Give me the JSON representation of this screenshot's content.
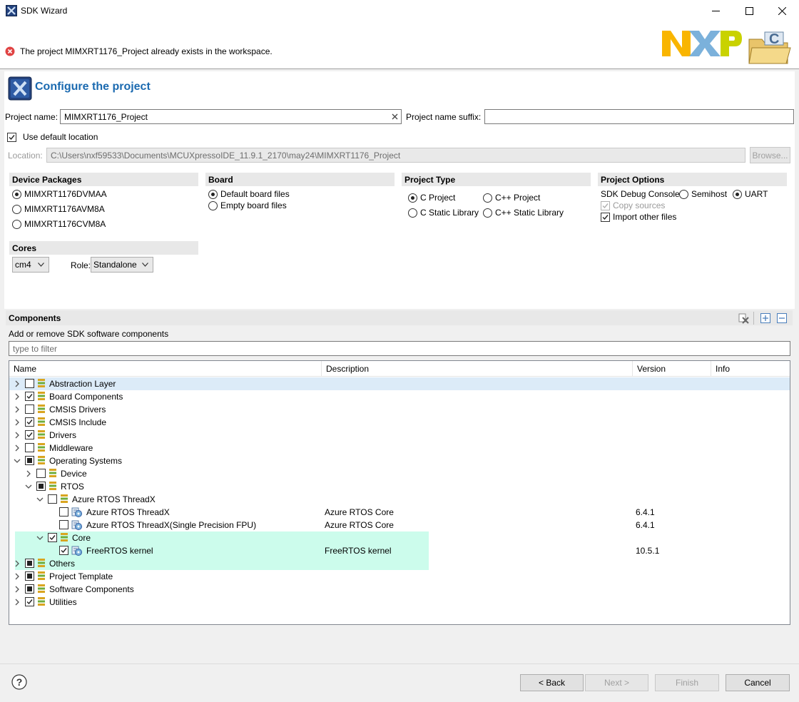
{
  "window": {
    "title": "SDK Wizard",
    "minimize_icon": "minimize-icon",
    "maximize_icon": "maximize-icon",
    "close_icon": "close-icon"
  },
  "banner": {
    "error_message": "The project MIMXRT1176_Project already exists in the workspace.",
    "logo_text": "NXP",
    "folder_letter": "C"
  },
  "page": {
    "title": "Configure the project"
  },
  "project": {
    "name_label": "Project name:",
    "name_value": "MIMXRT1176_Project",
    "suffix_label": "Project name suffix:",
    "suffix_value": "",
    "use_default_location_label": "Use default location",
    "use_default_location_checked": true,
    "location_label": "Location:",
    "location_value": "C:\\Users\\nxf59533\\Documents\\MCUXpressoIDE_11.9.1_2170\\may24\\MIMXRT1176_Project",
    "browse_label": "Browse..."
  },
  "device_packages": {
    "title": "Device Packages",
    "options": [
      "MIMXRT1176DVMAA",
      "MIMXRT1176AVM8A",
      "MIMXRT1176CVM8A"
    ],
    "selected": "MIMXRT1176DVMAA"
  },
  "board": {
    "title": "Board",
    "options": [
      "Default board files",
      "Empty board files"
    ],
    "selected": "Default board files"
  },
  "project_type": {
    "title": "Project Type",
    "options": [
      "C Project",
      "C++ Project",
      "C Static Library",
      "C++ Static Library"
    ],
    "selected": "C Project"
  },
  "project_options": {
    "title": "Project Options",
    "debug_console_label": "SDK Debug Console",
    "debug_console_options": [
      "Semihost",
      "UART"
    ],
    "debug_console_selected": "UART",
    "copy_sources_label": "Copy sources",
    "import_other_files_label": "Import other files"
  },
  "cores": {
    "title": "Cores",
    "core_value": "cm4",
    "role_label": "Role:",
    "role_value": "Standalone"
  },
  "components": {
    "title": "Components",
    "subtitle": "Add or remove SDK software components",
    "filter_placeholder": "type to filter",
    "columns": [
      "Name",
      "Description",
      "Version",
      "Info"
    ],
    "rows": [
      {
        "label": "Abstraction Layer",
        "desc": "",
        "ver": "",
        "level": 0,
        "exp": "closed",
        "check": "none",
        "icon": "package-icon",
        "bg": "#dcebf8"
      },
      {
        "label": "Board Components",
        "desc": "",
        "ver": "",
        "level": 0,
        "exp": "closed",
        "check": "checked",
        "icon": "package-icon",
        "bg": ""
      },
      {
        "label": "CMSIS Drivers",
        "desc": "",
        "ver": "",
        "level": 0,
        "exp": "closed",
        "check": "none",
        "icon": "package-icon",
        "bg": ""
      },
      {
        "label": "CMSIS Include",
        "desc": "",
        "ver": "",
        "level": 0,
        "exp": "closed",
        "check": "checked",
        "icon": "package-icon",
        "bg": ""
      },
      {
        "label": "Drivers",
        "desc": "",
        "ver": "",
        "level": 0,
        "exp": "closed",
        "check": "checked",
        "icon": "package-icon",
        "bg": ""
      },
      {
        "label": "Middleware",
        "desc": "",
        "ver": "",
        "level": 0,
        "exp": "closed",
        "check": "none",
        "icon": "package-icon",
        "bg": ""
      },
      {
        "label": "Operating Systems",
        "desc": "",
        "ver": "",
        "level": 0,
        "exp": "open",
        "check": "partial",
        "icon": "package-icon",
        "bg": ""
      },
      {
        "label": "Device",
        "desc": "",
        "ver": "",
        "level": 1,
        "exp": "closed",
        "check": "none",
        "icon": "package-icon",
        "bg": ""
      },
      {
        "label": "RTOS",
        "desc": "",
        "ver": "",
        "level": 1,
        "exp": "open",
        "check": "partial",
        "icon": "package-icon",
        "bg": ""
      },
      {
        "label": "Azure RTOS ThreadX",
        "desc": "",
        "ver": "",
        "level": 2,
        "exp": "open",
        "check": "none",
        "icon": "package-icon",
        "bg": ""
      },
      {
        "label": "Azure RTOS ThreadX",
        "desc": "Azure RTOS Core",
        "ver": "6.4.1",
        "level": 3,
        "exp": "",
        "check": "none",
        "icon": "component-icon",
        "bg": ""
      },
      {
        "label": "Azure RTOS ThreadX(Single Precision FPU)",
        "desc": "Azure RTOS Core",
        "ver": "6.4.1",
        "level": 3,
        "exp": "",
        "check": "none",
        "icon": "component-icon",
        "bg": ""
      },
      {
        "label": "Core",
        "desc": "",
        "ver": "",
        "level": 2,
        "exp": "open",
        "check": "checked",
        "icon": "package-icon",
        "bg": "#ccfcec"
      },
      {
        "label": "FreeRTOS kernel",
        "desc": "FreeRTOS kernel",
        "ver": "10.5.1",
        "level": 3,
        "exp": "",
        "check": "checked",
        "icon": "component-icon",
        "bg": "#ccfcec"
      },
      {
        "label": "Others",
        "desc": "",
        "ver": "",
        "level": 0,
        "exp": "closed",
        "check": "partial",
        "icon": "package-icon",
        "bg": "#ccfcec"
      },
      {
        "label": "Project Template",
        "desc": "",
        "ver": "",
        "level": 0,
        "exp": "closed",
        "check": "partial",
        "icon": "package-icon",
        "bg": ""
      },
      {
        "label": "Software Components",
        "desc": "",
        "ver": "",
        "level": 0,
        "exp": "closed",
        "check": "partial",
        "icon": "package-icon",
        "bg": ""
      },
      {
        "label": "Utilities",
        "desc": "",
        "ver": "",
        "level": 0,
        "exp": "closed",
        "check": "checked",
        "icon": "package-icon",
        "bg": ""
      }
    ]
  },
  "footer": {
    "help_icon": "help-icon",
    "back_label": "< Back",
    "next_label": "Next >",
    "finish_label": "Finish",
    "cancel_label": "Cancel"
  },
  "colors": {
    "title_blue": "#1b6ab0",
    "highlight_blue": "#dcebf8",
    "highlight_green": "#ccfcec",
    "error_red": "#e04343",
    "nxp_yellow": "#f9b500",
    "nxp_green": "#c9d200",
    "nxp_blue": "#7bb1db"
  }
}
